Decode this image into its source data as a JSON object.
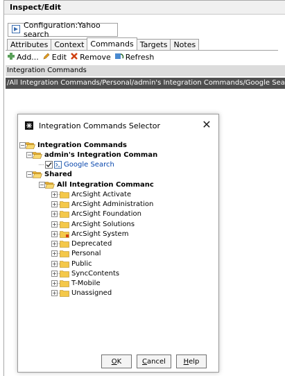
{
  "panel": {
    "title": "Inspect/Edit",
    "resource_tab": "Configuration:Yahoo search"
  },
  "tabs": [
    {
      "label": "Attributes",
      "active": false
    },
    {
      "label": "Context",
      "active": false
    },
    {
      "label": "Commands",
      "active": true
    },
    {
      "label": "Targets",
      "active": false
    },
    {
      "label": "Notes",
      "active": false
    }
  ],
  "toolbar": {
    "add_label": "Add...",
    "edit_label": "Edit",
    "remove_label": "Remove",
    "refresh_label": "Refresh"
  },
  "section": {
    "title": "Integration Commands",
    "path": "/All Integration Commands/Personal/admin's Integration Commands/Google Search"
  },
  "dialog": {
    "title": "Integration Commands Selector",
    "close_glyph": "✕",
    "tree": {
      "root": "Integration Commands",
      "admin_group": "admin's Integration Comman",
      "google_search": "Google Search",
      "shared": "Shared",
      "all_commands": "All Integration Commanc",
      "folders": [
        "ArcSight Activate",
        "ArcSight Administration",
        "ArcSight Foundation",
        "ArcSight Solutions",
        "ArcSight System",
        "Deprecated",
        "Personal",
        "Public",
        "SyncContents",
        "T-Mobile",
        "Unassigned"
      ]
    },
    "buttons": {
      "ok_pre": "",
      "ok_u": "O",
      "ok_post": "K",
      "cancel_pre": "",
      "cancel_u": "C",
      "cancel_post": "ancel",
      "help_pre": "",
      "help_u": "H",
      "help_post": "elp"
    }
  },
  "colors": {
    "path_bar": "#4f4f4f",
    "section_bar": "#dcdcdc",
    "folder": "#f4c84a",
    "link": "#0645ad"
  }
}
